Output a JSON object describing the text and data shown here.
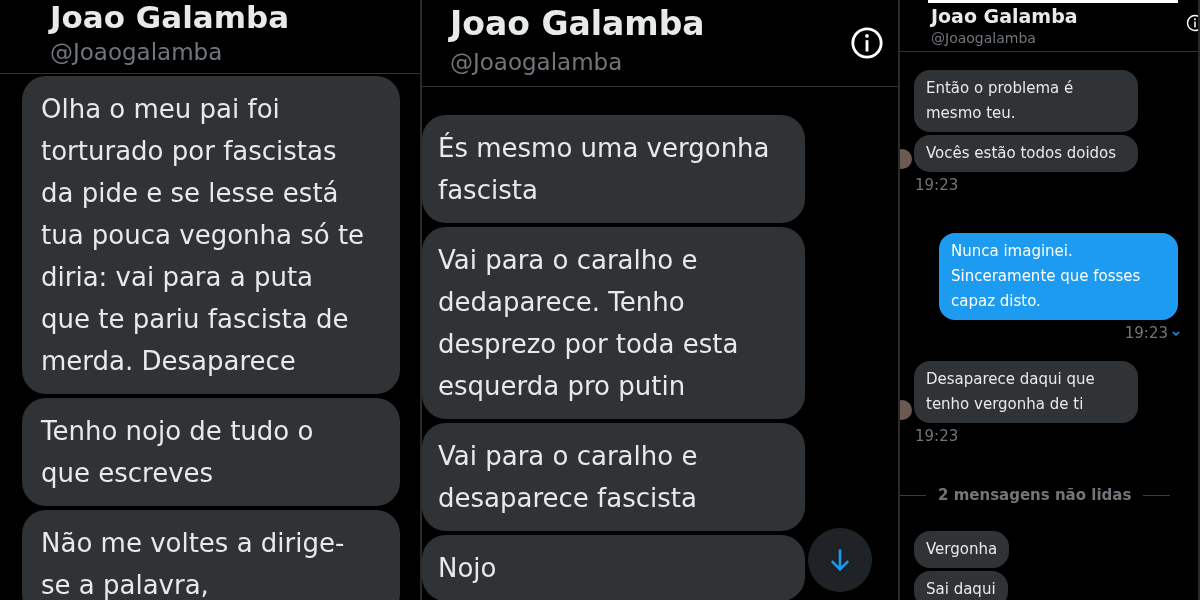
{
  "panels": [
    {
      "header": {
        "name": "Joao Galamba",
        "handle": "@Joaogalamba",
        "info_button": false
      },
      "scroll_down_button": false,
      "items": [
        {
          "kind": "received_message",
          "text": "Olha o meu pai foi torturado por fascistas da pide e se lesse está tua pouca vegonha só te diria: vai para a puta que te pariu fascista de merda. Desaparece"
        },
        {
          "kind": "received_message",
          "text": "Tenho nojo de tudo o que escreves"
        },
        {
          "kind": "received_message",
          "text": "Não me voltes a dirige-se a palavra,"
        }
      ]
    },
    {
      "header": {
        "name": "Joao Galamba",
        "handle": "@Joaogalamba",
        "info_button": true
      },
      "scroll_down_button": true,
      "items": [
        {
          "kind": "received_message",
          "text": "És mesmo uma vergonha fascista"
        },
        {
          "kind": "received_message",
          "text": "Vai para o caralho e dedaparece. Tenho desprezo por toda esta esquerda pro putin"
        },
        {
          "kind": "received_message",
          "text": "Vai para o caralho e desaparece fascista"
        },
        {
          "kind": "received_message",
          "text": "Nojo"
        }
      ]
    },
    {
      "header": {
        "name": "Joao Galamba",
        "handle": "@Joaogalamba",
        "info_button": true
      },
      "scroll_down_button": false,
      "items": [
        {
          "kind": "received_message",
          "text": "Então o problema é mesmo teu.",
          "avatar": false
        },
        {
          "kind": "received_message",
          "text": "Vocês estão todos doidos",
          "avatar": true
        },
        {
          "kind": "received_time",
          "text": "19:23"
        },
        {
          "kind": "sent_message",
          "text": "Nunca imaginei. Sinceramente que fosses capaz disto.",
          "avatar": false
        },
        {
          "kind": "sent_time",
          "text": "19:23",
          "seen": true
        },
        {
          "kind": "received_message",
          "text": "Desaparece daqui que tenho vergonha de ti",
          "avatar": true
        },
        {
          "kind": "received_time",
          "text": "19:23"
        },
        {
          "kind": "divider",
          "text": "2 mensagens não lidas"
        },
        {
          "kind": "received_message",
          "text": "Vergonha",
          "avatar": false
        },
        {
          "kind": "received_message",
          "text": "Sai daqui",
          "avatar": false
        }
      ]
    }
  ]
}
